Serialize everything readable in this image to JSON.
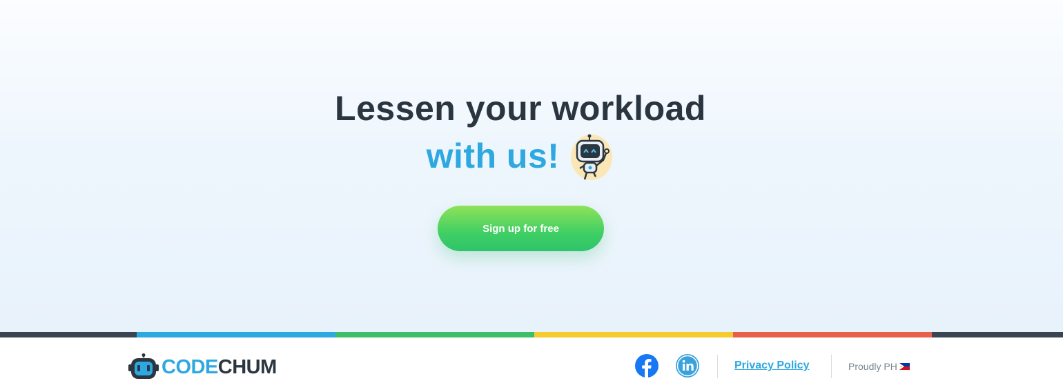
{
  "hero": {
    "headline_line1": "Lessen your workload",
    "headline_line2": "with us!",
    "mascot_icon": "robot-mascot-icon",
    "cta_label": "Sign up for free"
  },
  "footer": {
    "brand_part1": "CODE",
    "brand_part2": "CHUM",
    "social": [
      "facebook-icon",
      "linkedin-icon"
    ],
    "privacy_label": "Privacy Policy",
    "proudly_label": "Proudly PH",
    "flag_icon": "philippines-flag-icon"
  },
  "colors": {
    "brand_blue": "#2ea8e0",
    "dark_text": "#2a3540",
    "cta_green": "#3fcf64",
    "stripe": [
      "#3a4452",
      "#2ea8e0",
      "#3dbf6a",
      "#f5cc2e",
      "#e8604a",
      "#3a4452"
    ]
  }
}
